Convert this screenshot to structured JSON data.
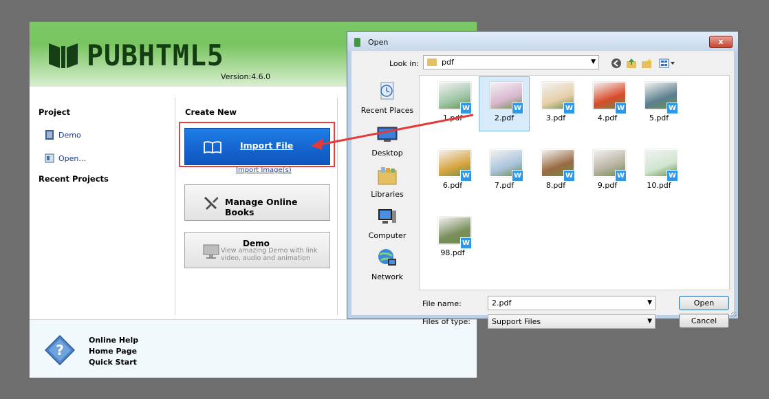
{
  "app": {
    "logo": "PUBHTML5",
    "version": "Version:4.6.0",
    "project": {
      "title": "Project",
      "items": [
        {
          "label": "Demo"
        },
        {
          "label": "Open..."
        }
      ],
      "recent_title": "Recent Projects"
    },
    "create": {
      "title": "Create New",
      "import_file": "Import File",
      "import_images": "Import Image(s)",
      "manage_online": "Manage Online Books",
      "demo_title": "Demo",
      "demo_sub": "View amazing Demo with link video, audio and animation"
    },
    "footer": {
      "links": [
        "Online Help",
        "Home Page",
        "Quick Start"
      ]
    }
  },
  "dialog": {
    "title": "Open",
    "close": "x",
    "look_in_label": "Look in:",
    "look_in_value": "pdf",
    "places": [
      "Recent Places",
      "Desktop",
      "Libraries",
      "Computer",
      "Network"
    ],
    "files": [
      {
        "name": "1.pdf",
        "selected": false,
        "color": "#9fc6a8"
      },
      {
        "name": "2.pdf",
        "selected": true,
        "color": "#d9b6cf"
      },
      {
        "name": "3.pdf",
        "selected": false,
        "color": "#e6cfa9"
      },
      {
        "name": "4.pdf",
        "selected": false,
        "color": "#d94a2a"
      },
      {
        "name": "5.pdf",
        "selected": false,
        "color": "#5b7f8f"
      },
      {
        "name": "6.pdf",
        "selected": false,
        "color": "#d9a640"
      },
      {
        "name": "7.pdf",
        "selected": false,
        "color": "#a9c4dc"
      },
      {
        "name": "8.pdf",
        "selected": false,
        "color": "#9a6a42"
      },
      {
        "name": "9.pdf",
        "selected": false,
        "color": "#b9b2a0"
      },
      {
        "name": "10.pdf",
        "selected": false,
        "color": "#cfe6cf"
      },
      {
        "name": "98.pdf",
        "selected": false,
        "color": "#7a8f5a"
      }
    ],
    "file_name_label": "File name:",
    "file_name_value": "2.pdf",
    "file_type_label": "Files of type:",
    "file_type_value": "Support Files",
    "open_button": "Open",
    "cancel_button": "Cancel"
  },
  "colors": {
    "import_blue": "#1565d0",
    "highlight_red": "#e84040",
    "header_green": "#7cc766"
  }
}
